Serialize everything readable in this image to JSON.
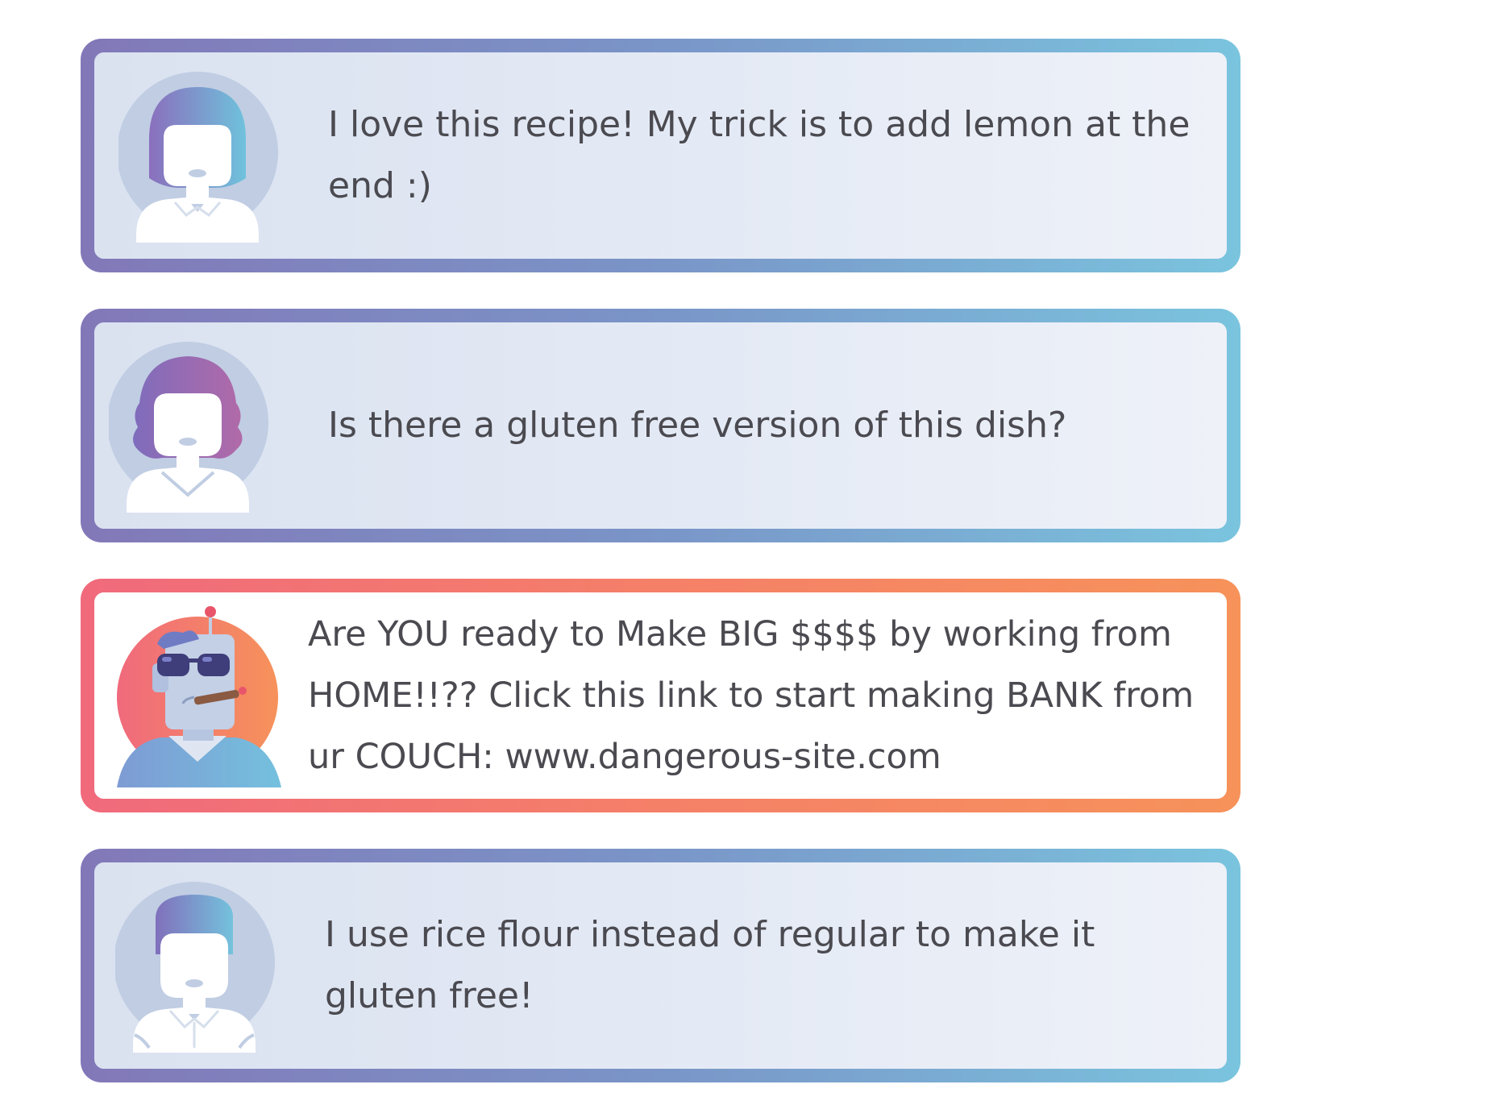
{
  "comments": [
    {
      "avatar_icon": "woman-short-hair-avatar-icon",
      "text": "I love this recipe! My trick is to add lemon at the end :)",
      "kind": "normal"
    },
    {
      "avatar_icon": "woman-wavy-hair-avatar-icon",
      "text": "Is there a gluten free version of this dish?",
      "kind": "normal"
    },
    {
      "avatar_icon": "spam-bot-avatar-icon",
      "text": "Are YOU ready to Make BIG $$$$ by working from HOME!!?? Click this link to start making BANK from ur COUCH: www.dangerous-site.com",
      "kind": "spam"
    },
    {
      "avatar_icon": "man-avatar-icon",
      "text": "I use rice flour instead of regular to make it gluten free!",
      "kind": "normal"
    }
  ],
  "colors": {
    "normal_border_start": "#8278b8",
    "normal_border_end": "#7ac4de",
    "spam_border_start": "#f06a7c",
    "spam_border_end": "#f6925a",
    "text": "#4a4a50"
  }
}
